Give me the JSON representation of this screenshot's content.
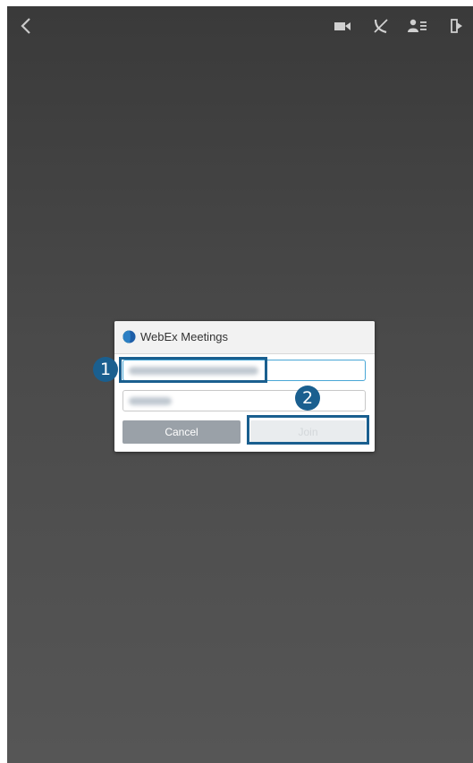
{
  "dialog": {
    "title": "WebEx Meetings",
    "cancel_label": "Cancel",
    "join_label": "Join"
  },
  "callouts": [
    "1",
    "2"
  ],
  "toolbar": {
    "icons": [
      "back-icon",
      "video-camera-icon",
      "mute-call-icon",
      "participants-icon",
      "exit-icon"
    ]
  },
  "colors": {
    "callout": "#1a5f8f",
    "field_focus": "#49a7d6",
    "cancel_button": "#9aa1a8"
  }
}
